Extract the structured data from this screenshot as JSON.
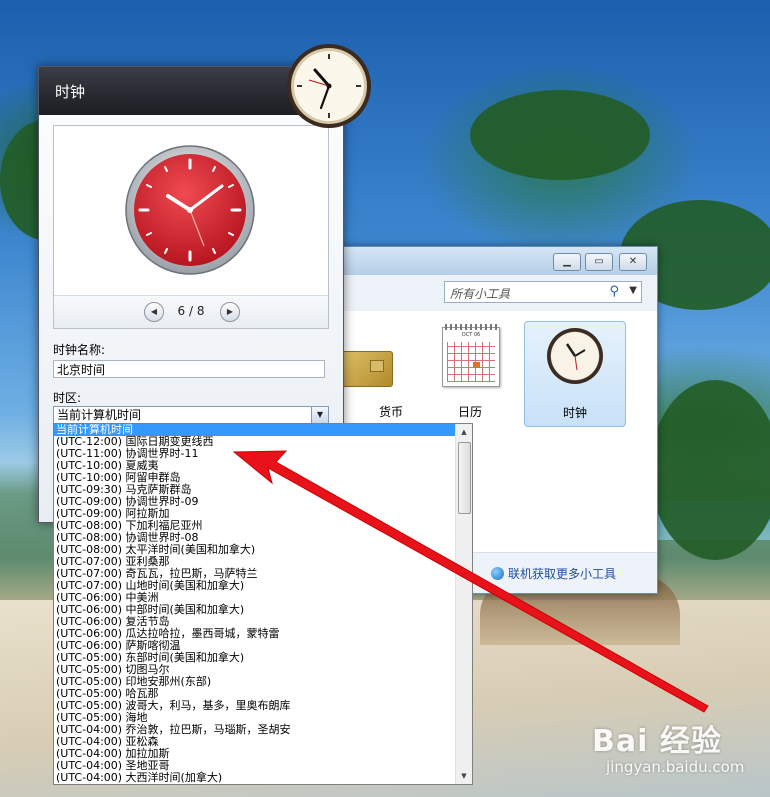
{
  "settings_panel": {
    "title": "时钟",
    "page_indicator": "6 / 8",
    "clock_name_label": "时钟名称:",
    "clock_name_value": "北京时间",
    "timezone_label": "时区:",
    "timezone_selected": "当前计算机时间"
  },
  "gallery": {
    "search_placeholder": "所有小工具",
    "items": [
      {
        "label": "货币",
        "icon": "currency-card-icon"
      },
      {
        "label": "日历",
        "icon": "calendar-icon"
      },
      {
        "label": "时钟",
        "icon": "clock-icon"
      }
    ],
    "online_link": "联机获取更多小工具",
    "calendar_month": "OCT 06"
  },
  "timezone_options": [
    "当前计算机时间",
    "(UTC-12:00) 国际日期变更线西",
    "(UTC-11:00) 协调世界时-11",
    "(UTC-10:00) 夏威夷",
    "(UTC-10:00) 阿留申群岛",
    "(UTC-09:30) 马克萨斯群岛",
    "(UTC-09:00) 协调世界时-09",
    "(UTC-09:00) 阿拉斯加",
    "(UTC-08:00) 下加利福尼亚州",
    "(UTC-08:00) 协调世界时-08",
    "(UTC-08:00) 太平洋时间(美国和加拿大)",
    "(UTC-07:00) 亚利桑那",
    "(UTC-07:00) 奇瓦瓦，拉巴斯，马萨特兰",
    "(UTC-07:00) 山地时间(美国和加拿大)",
    "(UTC-06:00) 中美洲",
    "(UTC-06:00) 中部时间(美国和加拿大)",
    "(UTC-06:00) 复活节岛",
    "(UTC-06:00) 瓜达拉哈拉，墨西哥城，蒙特雷",
    "(UTC-06:00) 萨斯喀彻温",
    "(UTC-05:00) 东部时间(美国和加拿大)",
    "(UTC-05:00) 切图马尔",
    "(UTC-05:00) 印地安那州(东部)",
    "(UTC-05:00) 哈瓦那",
    "(UTC-05:00) 波哥大，利马，基多，里奥布朗库",
    "(UTC-05:00) 海地",
    "(UTC-04:00) 乔治敦，拉巴斯，马瑙斯，圣胡安",
    "(UTC-04:00) 亚松森",
    "(UTC-04:00) 加拉加斯",
    "(UTC-04:00) 圣地亚哥",
    "(UTC-04:00) 大西洋时间(加拿大)"
  ],
  "watermark": {
    "logo": "Bai 经验",
    "url": "jingyan.baidu.com"
  },
  "colors": {
    "selection": "#3399ff",
    "arrow": "#e8121a",
    "clock_face_red": "#d81e2a"
  }
}
